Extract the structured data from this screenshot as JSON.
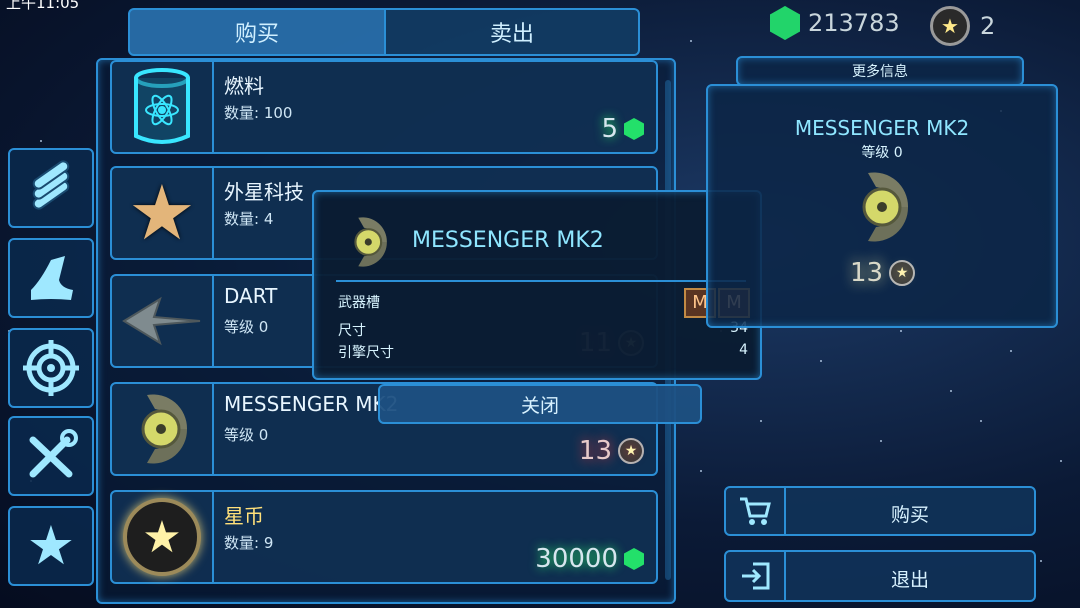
{
  "status": {
    "time": "上午11:05"
  },
  "currency": {
    "green_amount": "213783",
    "star_amount": "2"
  },
  "tabs": [
    {
      "label": "购买"
    },
    {
      "label": "卖出"
    }
  ],
  "side_buttons": [
    {
      "icon": "pipes-icon"
    },
    {
      "icon": "ship-part-icon"
    },
    {
      "icon": "target-icon"
    },
    {
      "icon": "tools-icon"
    },
    {
      "icon": "star-icon"
    }
  ],
  "items": [
    {
      "name": "燃料",
      "sub": "数量: 100",
      "price": "5",
      "currency": "green-hex"
    },
    {
      "name": "外星科技",
      "sub": "数量: 4",
      "price": "",
      "currency": "star"
    },
    {
      "name": "DART",
      "sub": "等级 0",
      "price": "11",
      "currency": "star"
    },
    {
      "name": "MESSENGER MK2",
      "sub": "等级 0",
      "price": "13",
      "currency": "star"
    },
    {
      "name": "星币",
      "sub": "数量: 9",
      "price": "30000",
      "currency": "green-hex"
    }
  ],
  "popup": {
    "title": "MESSENGER MK2",
    "rows": [
      {
        "label": "武器槽",
        "value": ""
      },
      {
        "label": "尺寸",
        "value": "34"
      },
      {
        "label": "引擎尺寸",
        "value": "4"
      }
    ],
    "slots": [
      "M",
      "M"
    ],
    "close_label": "关闭"
  },
  "info_panel": {
    "header": "更多信息",
    "title": "MESSENGER MK2",
    "level": "等级 0",
    "price": "13"
  },
  "actions": {
    "buy_label": "购买",
    "exit_label": "退出"
  }
}
